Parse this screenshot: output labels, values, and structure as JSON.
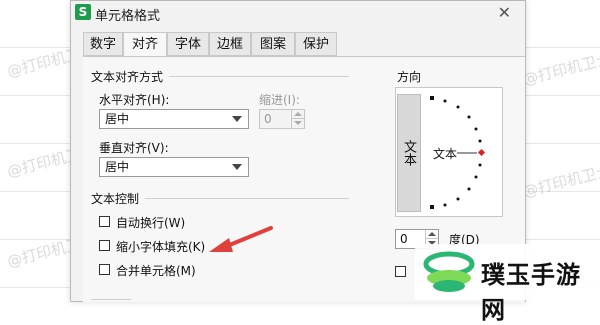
{
  "window": {
    "title": "单元格格式",
    "app_icon_letter": "S",
    "close_symbol": "✕"
  },
  "tabs": [
    {
      "label": "数字"
    },
    {
      "label": "对齐"
    },
    {
      "label": "字体"
    },
    {
      "label": "边框"
    },
    {
      "label": "图案"
    },
    {
      "label": "保护"
    }
  ],
  "active_tab": "对齐",
  "text_alignment": {
    "title": "文本对齐方式",
    "horizontal_label": "水平对齐(H):",
    "horizontal_value": "居中",
    "indent_label": "缩进(I):",
    "indent_value": "0",
    "vertical_label": "垂直对齐(V):",
    "vertical_value": "居中"
  },
  "text_control": {
    "title": "文本控制",
    "wrap_label": "自动换行(W)",
    "shrink_label": "缩小字体填充(K)",
    "merge_label": "合并单元格(M)"
  },
  "orientation": {
    "title": "方向",
    "vertical_text": "文本",
    "dial_text": "文本",
    "degree_value": "0",
    "degree_label": "度(D)",
    "marker_color": "#e02020"
  },
  "watermark_text": "@打印机卫士",
  "brand": {
    "name": "璞玉手游网",
    "logo_color": "#2bb673"
  },
  "annotation": {
    "arrow_color": "#e0413b"
  },
  "icons": [
    "spreadsheet-app-icon",
    "close-icon",
    "dropdown-arrow-icon",
    "spin-up-icon",
    "spin-down-icon",
    "annotation-arrow-icon",
    "brand-logo-icon"
  ]
}
